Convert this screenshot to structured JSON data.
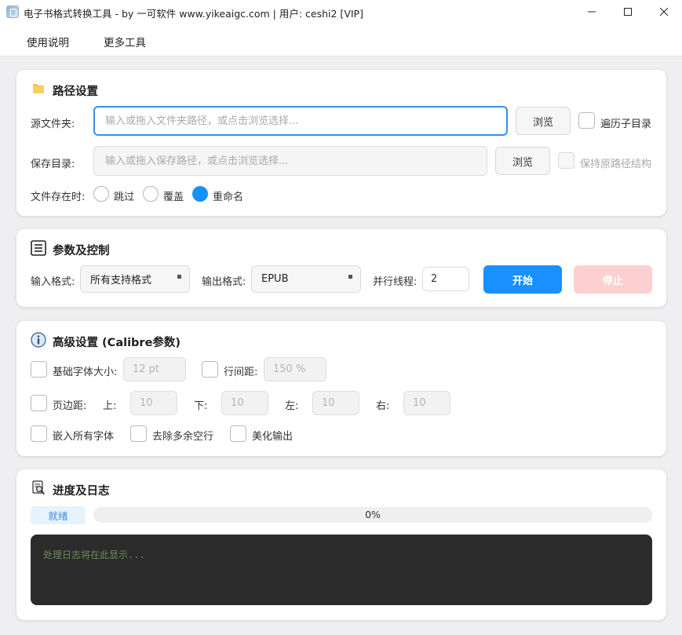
{
  "window": {
    "title": "电子书格式转换工具 - by 一可软件 www.yikeaigc.com | 用户: ceshi2 [VIP]"
  },
  "menu": {
    "items": [
      "使用说明",
      "更多工具"
    ]
  },
  "path_settings": {
    "title": "路径设置",
    "source_label": "源文件夹:",
    "source_placeholder": "输入或拖入文件夹路径，或点击浏览选择...",
    "browse_label": "浏览",
    "recursive_label": "遍历子目录",
    "output_label": "保存目录:",
    "output_placeholder": "输入或拖入保存路径，或点击浏览选择...",
    "browse2_label": "浏览",
    "keep_structure_label": "保持原路径结构",
    "exists_label": "文件存在时:",
    "exists_options": [
      "跳过",
      "覆盖",
      "重命名"
    ],
    "exists_selected": "重命名"
  },
  "params": {
    "title": "参数及控制",
    "input_format_label": "输入格式:",
    "input_format_value": "所有支持格式",
    "output_format_label": "输出格式:",
    "output_format_value": "EPUB",
    "threads_label": "并行线程:",
    "threads_value": "2",
    "start_label": "开始",
    "stop_label": "停止"
  },
  "advanced": {
    "title": "高级设置 (Calibre参数)",
    "base_font_label": "基础字体大小:",
    "base_font_value": "12 pt",
    "line_height_label": "行间距:",
    "line_height_value": "150 %",
    "margin_label": "页边距:",
    "margin_top_label": "上:",
    "margin_top_value": "10",
    "margin_bottom_label": "下:",
    "margin_bottom_value": "10",
    "margin_left_label": "左:",
    "margin_left_value": "10",
    "margin_right_label": "右:",
    "margin_right_value": "10",
    "embed_fonts_label": "嵌入所有字体",
    "remove_blank_label": "去除多余空行",
    "pretty_label": "美化输出"
  },
  "progress": {
    "title": "进度及日志",
    "status": "就绪",
    "percent_text": "0%",
    "fraction": 0,
    "log_placeholder": "处理日志将在此显示..."
  },
  "colors": {
    "accent": "#1890ff",
    "focus_border": "#3a8ee6",
    "stop_disabled": "#fcd0d0",
    "log_bg": "#2b2b2b"
  }
}
